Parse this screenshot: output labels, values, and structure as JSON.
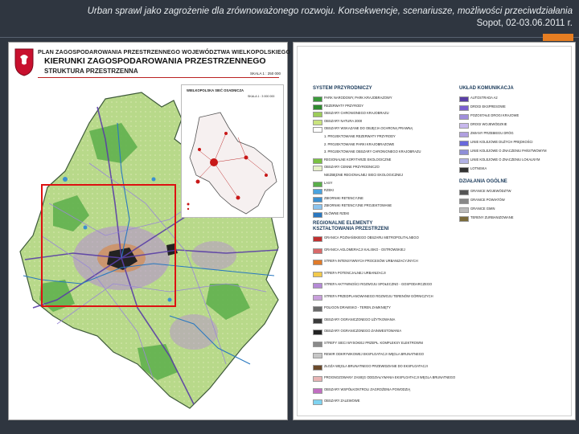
{
  "slide": {
    "header_line1": "Urban sprawl jako zagrożenie dla zrównoważonego rozwoju. Konsekwencje, scenariusze, możliwości przeciwdziałania",
    "header_line2": "Sopot, 02-03.06.2011 r.",
    "accent_color": "#e67e22"
  },
  "map": {
    "title_line1": "PLAN  ZAGOSPODAROWANIA  PRZESTRZENNEGO  WOJEWÓDZTWA  WIELKOPOLSKIEGO",
    "title_line2": "KIERUNKI ZAGOSPODAROWANIA PRZESTRZENNEGO",
    "title_line3": "STRUKTURA PRZESTRZENNA",
    "scale": "SKALA  1 : 250 000",
    "inset_title": "WIELKOPOLSKA  SIEĆ OSADNICZA",
    "inset_scale": "SKALA 1 : 3 000 000",
    "highlight_color": "#dd1111",
    "crest_icon": "wielkopolska-crest-icon"
  },
  "legend": {
    "left_title1": "SYSTEM PRZYRODNICZY",
    "left_items1": [
      {
        "label": "PARK NARODOWY, PARK KRAJOBRAZOWY",
        "color": "#3c9b3c"
      },
      {
        "label": "REZERWATY PRZYRODY",
        "color": "#2f8a2f"
      },
      {
        "label": "OBSZARY CHRONIONEGO KRAJOBRAZU",
        "color": "#9ccc5a"
      },
      {
        "label": "OBSZARY NATURA 2000",
        "color": "#c9e37e"
      },
      {
        "label": "OBSZARY WSKAZANE DO OBJĘCIA OCHRONĄ PRAWNĄ",
        "color": "#ffffff"
      },
      {
        "label": "1. PROJEKTOWANE REZERWATY PRZYRODY",
        "color": ""
      },
      {
        "label": "2. PROJEKTOWANE PARKI KRAJOBRAZOWE",
        "color": ""
      },
      {
        "label": "3. PROJEKTOWANE OBSZARY CHRONIONEGO KRAJOBRAZU",
        "color": ""
      },
      {
        "label": "REGIONALNE KORYTARZE EKOLOGICZNE",
        "color": "#7ac142"
      },
      {
        "label": "OBSZARY CENNE PRZYRODNICZO",
        "color": "#e7f2c8"
      },
      {
        "label": "NIEZBĘDNE REGIONALNEJ SIECI EKOLOGICZNEJ",
        "color": ""
      },
      {
        "label": "LASY",
        "color": "#5aae4a"
      },
      {
        "label": "RZEKI",
        "color": "#4aa3df"
      },
      {
        "label": "ZBIORNIKI RETENCYJNE",
        "color": "#3b8fd0"
      },
      {
        "label": "ZBIORNIKI RETENCYJNE PROJEKTOWANE",
        "color": "#8cc4ee"
      },
      {
        "label": "GŁÓWNE RZEKI",
        "color": "#2a78c0"
      }
    ],
    "left_title2": "REGIONALNE ELEMENTY",
    "left_title2b": "KSZTAŁTOWANIA PRZESTRZENI",
    "left_items2": [
      {
        "label": "GRANICA POZNAŃSKIEGO OBSZARU METROPOLITALNEGO",
        "color": "#c03030"
      },
      {
        "label": "GRANICA AGLOMERACJI KALISKO - OSTROWSKIEJ",
        "color": "#d86a6a"
      },
      {
        "label": "STREFA INTENSYWNYCH PROCESÓW URBANIZACYJNYCH",
        "color": "#e07b2a"
      },
      {
        "label": "STREFA POTENCJALNEJ URBANIZACJI",
        "color": "#f2c94c"
      },
      {
        "label": "STREFA AKTYWNOŚCI ROZWOJU SPOŁECZNO - GOSPODARCZEGO",
        "color": "#b58ad6"
      },
      {
        "label": "STREFA PRZEDPLANOWANEGO ROZWOJU TERENÓW GÓRNICZYCH",
        "color": "#c9a0dc"
      },
      {
        "label": "POLIGON DRAWSKO - TEREN ZAMKNIĘTY",
        "color": "#6b6b6b"
      },
      {
        "label": "OBSZARY OGRANICZONEGO UŻYTKOWANIA",
        "color": "#3a3a3a"
      },
      {
        "label": "OBSZARY OGRANICZONEGO ZAINWESTOWANIA",
        "color": "#222222"
      },
      {
        "label": "STREFY SIECI WYSOKIEJ PRZEPŁ. KOMPLEKSY ELEKTROWNI",
        "color": "#8a8a8a"
      },
      {
        "label": "REWIR ODKRYWKOWEJ EKSPLOATACJI WĘGLA BRUNATNEGO",
        "color": "#c7c7c7"
      },
      {
        "label": "ZŁOŻA WĘGLA BRUNATNEGO PRZEWIDZIANE DO EKSPLOATACJI",
        "color": "#6b4a2b"
      },
      {
        "label": "PROGNOZOWANY ZASIĘG ODDZIAŁYWANIA EKSPLOATACJI WĘGLA BRUNATNEGO",
        "color": "#e8b5b5"
      },
      {
        "label": "OBSZARY WSPÓŁKONTROLI ZAGROŻENIA POWODZIĄ",
        "color": "#c26ec2"
      },
      {
        "label": "OBSZARY ZALEWOWE",
        "color": "#7fd3f0"
      }
    ],
    "right_title1": "UKŁAD KOMUNIKACJA",
    "right_items1": [
      {
        "label": "AUTOSTRADA A2",
        "color": "#5a3fa6"
      },
      {
        "label": "DROGI EKSPRESOWE",
        "color": "#7a5fd0"
      },
      {
        "label": "POZOSTAŁE DROGI KRAJOWE",
        "color": "#a08fdc"
      },
      {
        "label": "DROGI WOJEWÓDZKIE",
        "color": "#c8b8ee"
      },
      {
        "label": "ZMIANY PRZEBIEGU DRÓG",
        "color": "#b0a0e0"
      },
      {
        "label": "LINIE KOLEJOWE DUŻYCH PRĘDKOŚCI",
        "color": "#6a6adc"
      },
      {
        "label": "LINIE KOLEJOWE O ZNACZENIU PAŃSTWOWYM",
        "color": "#8f8fd8"
      },
      {
        "label": "LINIE KOLEJOWE O ZNACZENIU LOKALNYM",
        "color": "#b3b3e6"
      },
      {
        "label": "LOTNISKA",
        "color": "#333333"
      }
    ],
    "right_title2": "DZIAŁANIA OGÓLNE",
    "right_items2": [
      {
        "label": "GRANICE WOJEWÓDZTW",
        "color": "#555555"
      },
      {
        "label": "GRANICE POWIATÓW",
        "color": "#888888"
      },
      {
        "label": "GRANICE GMIN",
        "color": "#bbbbbb"
      },
      {
        "label": "TERENY ZURBANIZOWANE",
        "color": "#7a6a3a"
      }
    ]
  }
}
